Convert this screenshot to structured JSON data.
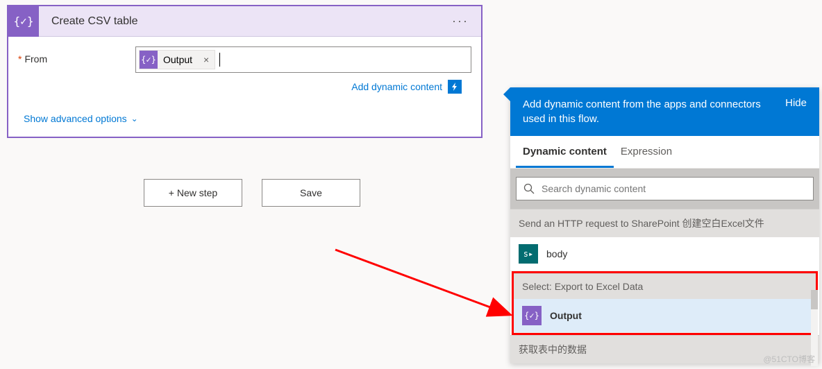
{
  "action": {
    "title": "Create CSV table",
    "icon_glyph": "{✓}",
    "params": {
      "from_label": "From",
      "token_label": "Output",
      "token_icon": "{✓}"
    },
    "add_dynamic_label": "Add dynamic content",
    "advanced_label": "Show advanced options"
  },
  "buttons": {
    "new_step": "+ New step",
    "save": "Save"
  },
  "panel": {
    "header_text": "Add dynamic content from the apps and connectors used in this flow.",
    "hide": "Hide",
    "tabs": {
      "dynamic": "Dynamic content",
      "expression": "Expression"
    },
    "search_placeholder": "Search dynamic content",
    "groups": {
      "http": "Send an HTTP request to SharePoint 创建空白Excel文件",
      "select": "Select: Export to Excel Data",
      "getrows": "获取表中的数据"
    },
    "items": {
      "body": "body",
      "output": "Output"
    }
  },
  "watermark": "@51CTO博客"
}
